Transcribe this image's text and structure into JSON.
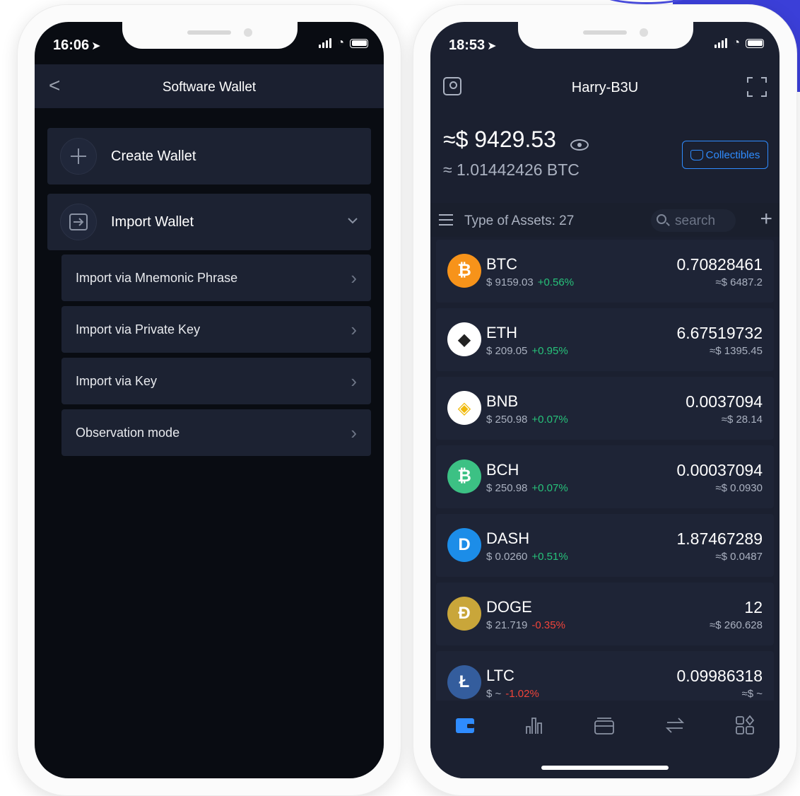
{
  "left_phone": {
    "status": {
      "time": "16:06"
    },
    "nav": {
      "back": "<",
      "title": "Software Wallet"
    },
    "create_wallet": "Create Wallet",
    "import_wallet": "Import Wallet",
    "import_options": [
      {
        "label": "Import via Mnemonic Phrase"
      },
      {
        "label": "Import via Private Key"
      },
      {
        "label": "Import via Key"
      },
      {
        "label": "Observation mode"
      }
    ]
  },
  "right_phone": {
    "status": {
      "time": "18:53"
    },
    "wallet_name": "Harry-B3U",
    "balance_usd": "≈$ 9429.53",
    "balance_btc": "≈ 1.01442426 BTC",
    "collectibles": "Collectibles",
    "assets_label": "Type of Assets: 27",
    "search_placeholder": "search",
    "assets": [
      {
        "symbol": "BTC",
        "price": "$ 9159.03",
        "change": "+0.56%",
        "quantity": "0.70828461",
        "value": "≈$ 6487.2",
        "color": "#f7931a",
        "glyph": "₿",
        "change_color": "#27c27a"
      },
      {
        "symbol": "ETH",
        "price": "$ 209.05",
        "change": "+0.95%",
        "quantity": "6.67519732",
        "value": "≈$ 1395.45",
        "color": "#ffffff",
        "glyph": "◆",
        "change_color": "#27c27a"
      },
      {
        "symbol": "BNB",
        "price": "$ 250.98",
        "change": "+0.07%",
        "quantity": "0.0037094",
        "value": "≈$ 28.14",
        "color": "#ffffff",
        "glyph": "◈",
        "change_color": "#27c27a"
      },
      {
        "symbol": "BCH",
        "price": "$ 250.98",
        "change": "+0.07%",
        "quantity": "0.00037094",
        "value": "≈$ 0.0930",
        "color": "#3cc184",
        "glyph": "₿",
        "change_color": "#27c27a"
      },
      {
        "symbol": "DASH",
        "price": "$ 0.0260",
        "change": "+0.51%",
        "quantity": "1.87467289",
        "value": "≈$ 0.0487",
        "color": "#1c8de8",
        "glyph": "D",
        "change_color": "#27c27a"
      },
      {
        "symbol": "DOGE",
        "price": "$ 21.719",
        "change": "-0.35%",
        "quantity": "12",
        "value": "≈$ 260.628",
        "color": "#c9a63a",
        "glyph": "Ð",
        "change_color": "#f0443a"
      },
      {
        "symbol": "LTC",
        "price": "$ ~",
        "change": "-1.02%",
        "quantity": "0.09986318",
        "value": "≈$ ~",
        "color": "#345d9d",
        "glyph": "Ł",
        "change_color": "#f0443a"
      }
    ],
    "tabs": [
      "wallet-icon",
      "chart-icon",
      "cards-icon",
      "swap-icon",
      "apps-icon"
    ],
    "accent": "#2f8cff"
  }
}
